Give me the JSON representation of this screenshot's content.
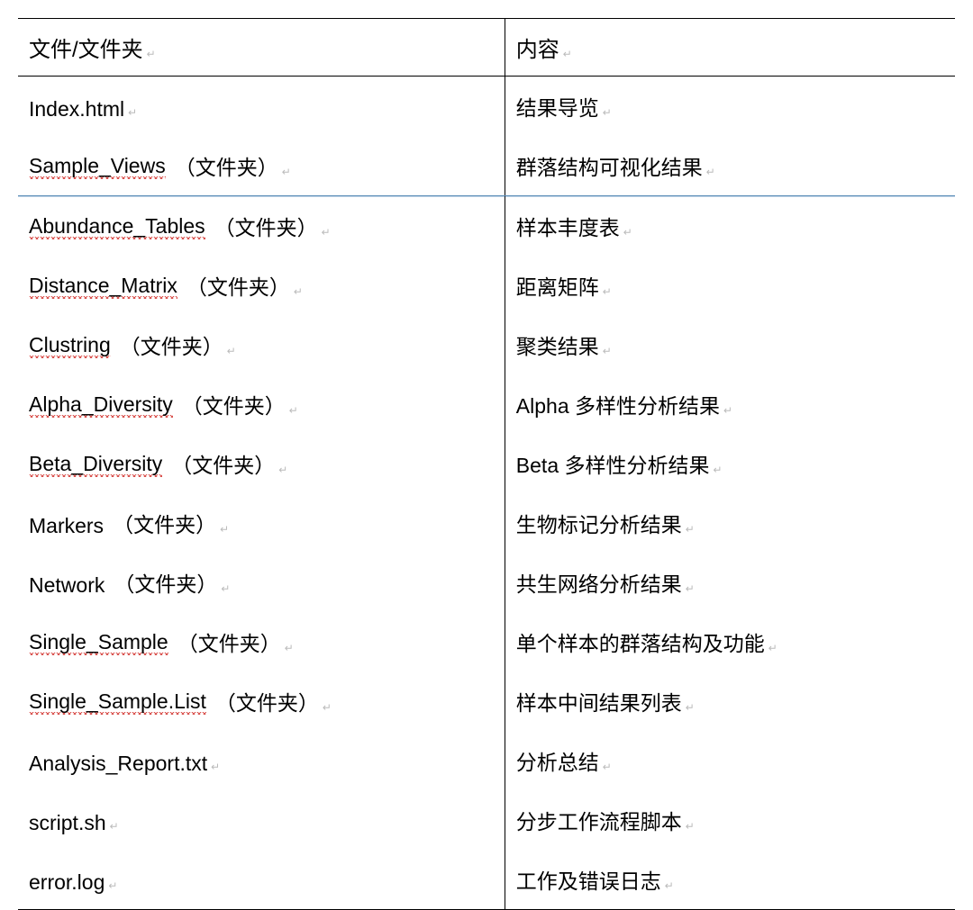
{
  "headers": {
    "left": "文件/文件夹",
    "right": "内容"
  },
  "rows": [
    {
      "name": "Index.html",
      "squiggle": false,
      "suffix": "",
      "desc": "结果导览",
      "descSquiggle": ""
    },
    {
      "name": "Sample_Views",
      "squiggle": true,
      "suffix": "（文件夹）",
      "desc": "群落结构可视化结果",
      "descSquiggle": ""
    },
    {
      "name": "Abundance_Tables",
      "squiggle": true,
      "suffix": "（文件夹）",
      "desc": "样本丰度表",
      "descSquiggle": ""
    },
    {
      "name": "Distance_Matrix",
      "squiggle": true,
      "suffix": "（文件夹）",
      "desc": "距离矩阵",
      "descSquiggle": ""
    },
    {
      "name": "Clustring",
      "squiggle": true,
      "suffix": "（文件夹）",
      "desc": "聚类结果",
      "descSquiggle": ""
    },
    {
      "name": "Alpha_Diversity",
      "squiggle": true,
      "suffix": "（文件夹）",
      "desc": "Alpha 多样性分析结果",
      "descSquiggle": ""
    },
    {
      "name": "Beta_Diversity",
      "squiggle": true,
      "suffix": "（文件夹）",
      "desc": "Beta 多样性分析结果",
      "descSquiggle": ""
    },
    {
      "name": "Markers",
      "squiggle": false,
      "suffix": "（文件夹）",
      "desc": "生物标记分析结果",
      "descSquiggle": ""
    },
    {
      "name": "Network",
      "squiggle": false,
      "suffix": "（文件夹）",
      "desc": "共生网络分析结果",
      "descSquiggle": ""
    },
    {
      "name": "Single_Sample",
      "squiggle": true,
      "suffix": "（文件夹）",
      "desc": "单个样本的群落结构及功能",
      "descSquiggle": ""
    },
    {
      "name": "Single_Sample.List",
      "squiggle": true,
      "suffix": "（文件夹）",
      "desc": "样本中间结果列表",
      "descSquiggle": ""
    },
    {
      "name": "Analysis_Report.txt",
      "squiggle": false,
      "suffix": "",
      "desc": "分析总结",
      "descSquiggle": ""
    },
    {
      "name": "script.sh",
      "squiggle": false,
      "suffix": "",
      "desc": "分步工作流程脚本",
      "descSquiggle": ""
    },
    {
      "name": "error.log",
      "squiggle": false,
      "suffix": "",
      "desc": "工作及错误日志",
      "descSquiggle": ""
    }
  ],
  "sectionBreakAfterIndex": 1,
  "endMark": "↵"
}
